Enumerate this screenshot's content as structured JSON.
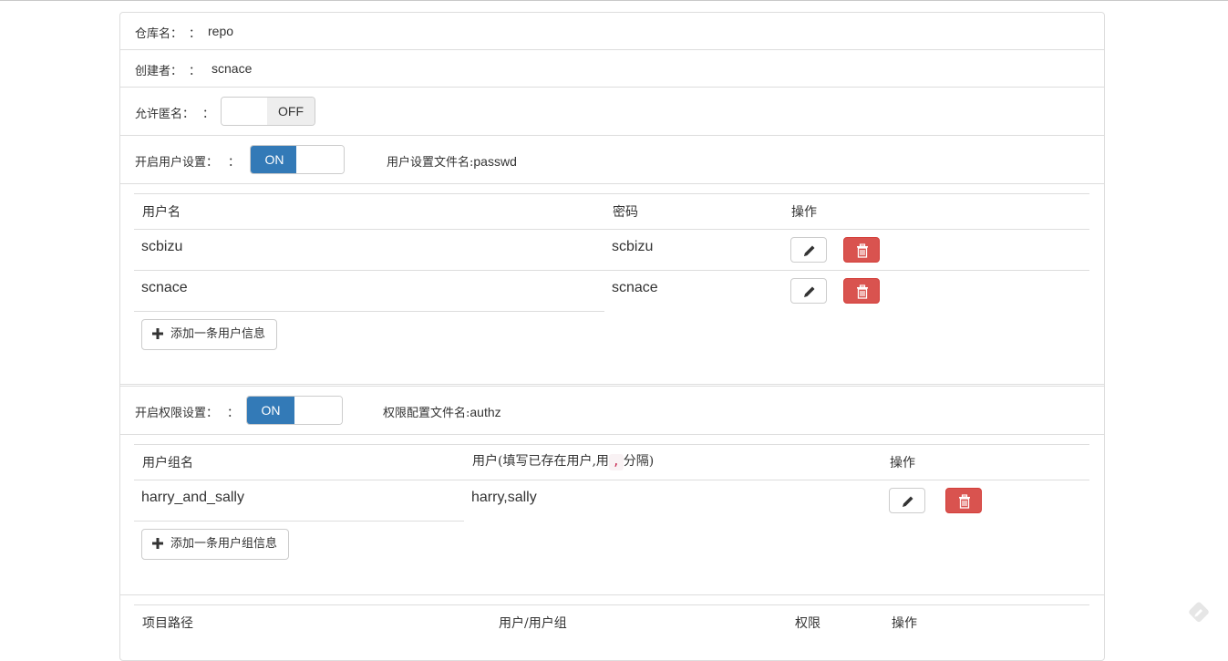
{
  "repo": {
    "label": "仓库名：",
    "colon": "：",
    "value": "repo"
  },
  "creator": {
    "label": "创建者：",
    "colon": "：",
    "value": "scnace"
  },
  "anonymous": {
    "label": "允许匿名：",
    "colon": "：",
    "toggle_state": "OFF"
  },
  "user_settings": {
    "label": "开启用户设置：",
    "colon": "：",
    "toggle_state": "ON",
    "file_label": "用户设置文件名:",
    "file_value": "passwd",
    "table": {
      "headers": [
        "用户名",
        "密码",
        "操作"
      ],
      "rows": [
        {
          "username": "scbizu",
          "password": "scbizu"
        },
        {
          "username": "scnace",
          "password": "scnace"
        }
      ]
    },
    "add_button": "添加一条用户信息"
  },
  "permission_settings": {
    "label": "开启权限设置：",
    "colon": "：",
    "toggle_state": "ON",
    "file_label": "权限配置文件名:",
    "file_value": "authz",
    "table": {
      "headers": [
        "用户组名",
        "用户(填写已存在用户,用",
        ",",
        "分隔)",
        "操作"
      ],
      "rows": [
        {
          "group": "harry_and_sally",
          "users": "harry,sally"
        }
      ]
    },
    "add_button": "添加一条用户组信息"
  },
  "path_table": {
    "headers": [
      "项目路径",
      "用户/用户组",
      "权限",
      "操作"
    ]
  },
  "colors": {
    "primary": "#337ab7",
    "danger": "#d9534f",
    "border": "#dddddd",
    "code": "#c7254e"
  },
  "icons": {
    "edit": "pencil-icon",
    "delete": "trash-icon",
    "add": "plus-icon",
    "corner": "feedback-icon"
  }
}
